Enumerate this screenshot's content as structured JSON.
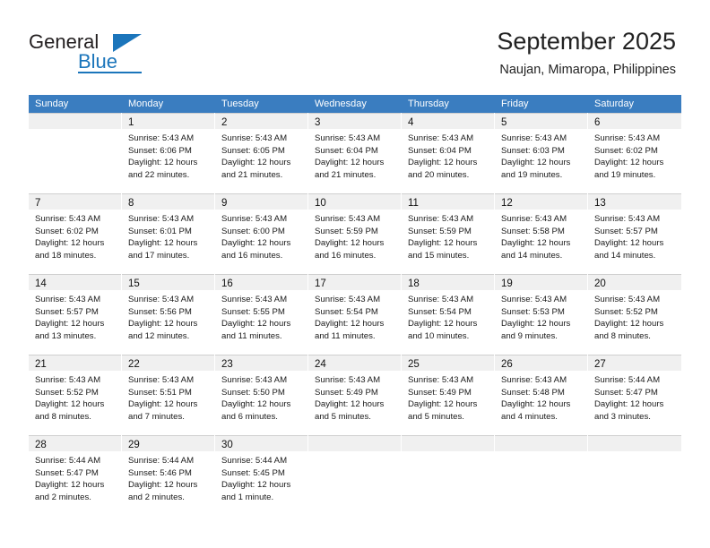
{
  "logo": {
    "word_top": "General",
    "word_bottom": "Blue",
    "accent_color": "#1b75bb",
    "triangle_icon": "triangle-right-icon"
  },
  "header": {
    "title": "September 2025",
    "location": "Naujan, Mimaropa, Philippines"
  },
  "calendar": {
    "header_bg": "#3a7dc0",
    "header_text_color": "#ffffff",
    "daynum_bg": "#f0f0f0",
    "weekdays": [
      "Sunday",
      "Monday",
      "Tuesday",
      "Wednesday",
      "Thursday",
      "Friday",
      "Saturday"
    ],
    "weeks": [
      [
        {
          "day": "",
          "lines": []
        },
        {
          "day": "1",
          "lines": [
            "Sunrise: 5:43 AM",
            "Sunset: 6:06 PM",
            "Daylight: 12 hours",
            "and 22 minutes."
          ]
        },
        {
          "day": "2",
          "lines": [
            "Sunrise: 5:43 AM",
            "Sunset: 6:05 PM",
            "Daylight: 12 hours",
            "and 21 minutes."
          ]
        },
        {
          "day": "3",
          "lines": [
            "Sunrise: 5:43 AM",
            "Sunset: 6:04 PM",
            "Daylight: 12 hours",
            "and 21 minutes."
          ]
        },
        {
          "day": "4",
          "lines": [
            "Sunrise: 5:43 AM",
            "Sunset: 6:04 PM",
            "Daylight: 12 hours",
            "and 20 minutes."
          ]
        },
        {
          "day": "5",
          "lines": [
            "Sunrise: 5:43 AM",
            "Sunset: 6:03 PM",
            "Daylight: 12 hours",
            "and 19 minutes."
          ]
        },
        {
          "day": "6",
          "lines": [
            "Sunrise: 5:43 AM",
            "Sunset: 6:02 PM",
            "Daylight: 12 hours",
            "and 19 minutes."
          ]
        }
      ],
      [
        {
          "day": "7",
          "lines": [
            "Sunrise: 5:43 AM",
            "Sunset: 6:02 PM",
            "Daylight: 12 hours",
            "and 18 minutes."
          ]
        },
        {
          "day": "8",
          "lines": [
            "Sunrise: 5:43 AM",
            "Sunset: 6:01 PM",
            "Daylight: 12 hours",
            "and 17 minutes."
          ]
        },
        {
          "day": "9",
          "lines": [
            "Sunrise: 5:43 AM",
            "Sunset: 6:00 PM",
            "Daylight: 12 hours",
            "and 16 minutes."
          ]
        },
        {
          "day": "10",
          "lines": [
            "Sunrise: 5:43 AM",
            "Sunset: 5:59 PM",
            "Daylight: 12 hours",
            "and 16 minutes."
          ]
        },
        {
          "day": "11",
          "lines": [
            "Sunrise: 5:43 AM",
            "Sunset: 5:59 PM",
            "Daylight: 12 hours",
            "and 15 minutes."
          ]
        },
        {
          "day": "12",
          "lines": [
            "Sunrise: 5:43 AM",
            "Sunset: 5:58 PM",
            "Daylight: 12 hours",
            "and 14 minutes."
          ]
        },
        {
          "day": "13",
          "lines": [
            "Sunrise: 5:43 AM",
            "Sunset: 5:57 PM",
            "Daylight: 12 hours",
            "and 14 minutes."
          ]
        }
      ],
      [
        {
          "day": "14",
          "lines": [
            "Sunrise: 5:43 AM",
            "Sunset: 5:57 PM",
            "Daylight: 12 hours",
            "and 13 minutes."
          ]
        },
        {
          "day": "15",
          "lines": [
            "Sunrise: 5:43 AM",
            "Sunset: 5:56 PM",
            "Daylight: 12 hours",
            "and 12 minutes."
          ]
        },
        {
          "day": "16",
          "lines": [
            "Sunrise: 5:43 AM",
            "Sunset: 5:55 PM",
            "Daylight: 12 hours",
            "and 11 minutes."
          ]
        },
        {
          "day": "17",
          "lines": [
            "Sunrise: 5:43 AM",
            "Sunset: 5:54 PM",
            "Daylight: 12 hours",
            "and 11 minutes."
          ]
        },
        {
          "day": "18",
          "lines": [
            "Sunrise: 5:43 AM",
            "Sunset: 5:54 PM",
            "Daylight: 12 hours",
            "and 10 minutes."
          ]
        },
        {
          "day": "19",
          "lines": [
            "Sunrise: 5:43 AM",
            "Sunset: 5:53 PM",
            "Daylight: 12 hours",
            "and 9 minutes."
          ]
        },
        {
          "day": "20",
          "lines": [
            "Sunrise: 5:43 AM",
            "Sunset: 5:52 PM",
            "Daylight: 12 hours",
            "and 8 minutes."
          ]
        }
      ],
      [
        {
          "day": "21",
          "lines": [
            "Sunrise: 5:43 AM",
            "Sunset: 5:52 PM",
            "Daylight: 12 hours",
            "and 8 minutes."
          ]
        },
        {
          "day": "22",
          "lines": [
            "Sunrise: 5:43 AM",
            "Sunset: 5:51 PM",
            "Daylight: 12 hours",
            "and 7 minutes."
          ]
        },
        {
          "day": "23",
          "lines": [
            "Sunrise: 5:43 AM",
            "Sunset: 5:50 PM",
            "Daylight: 12 hours",
            "and 6 minutes."
          ]
        },
        {
          "day": "24",
          "lines": [
            "Sunrise: 5:43 AM",
            "Sunset: 5:49 PM",
            "Daylight: 12 hours",
            "and 5 minutes."
          ]
        },
        {
          "day": "25",
          "lines": [
            "Sunrise: 5:43 AM",
            "Sunset: 5:49 PM",
            "Daylight: 12 hours",
            "and 5 minutes."
          ]
        },
        {
          "day": "26",
          "lines": [
            "Sunrise: 5:43 AM",
            "Sunset: 5:48 PM",
            "Daylight: 12 hours",
            "and 4 minutes."
          ]
        },
        {
          "day": "27",
          "lines": [
            "Sunrise: 5:44 AM",
            "Sunset: 5:47 PM",
            "Daylight: 12 hours",
            "and 3 minutes."
          ]
        }
      ],
      [
        {
          "day": "28",
          "lines": [
            "Sunrise: 5:44 AM",
            "Sunset: 5:47 PM",
            "Daylight: 12 hours",
            "and 2 minutes."
          ]
        },
        {
          "day": "29",
          "lines": [
            "Sunrise: 5:44 AM",
            "Sunset: 5:46 PM",
            "Daylight: 12 hours",
            "and 2 minutes."
          ]
        },
        {
          "day": "30",
          "lines": [
            "Sunrise: 5:44 AM",
            "Sunset: 5:45 PM",
            "Daylight: 12 hours",
            "and 1 minute."
          ]
        },
        {
          "day": "",
          "lines": []
        },
        {
          "day": "",
          "lines": []
        },
        {
          "day": "",
          "lines": []
        },
        {
          "day": "",
          "lines": []
        }
      ]
    ]
  }
}
